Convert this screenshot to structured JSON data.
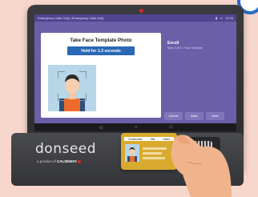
{
  "status_bar": {
    "left_text": "Emergency Calls Only  |  Emergency Calls Only",
    "time": "12:34"
  },
  "enroll_card": {
    "title": "Take Face Template Photo",
    "button_label": "Hold for 1-3 seconds"
  },
  "side_panel": {
    "title": "Enroll",
    "subtitle": "Step 3 of 5 : Face Template"
  },
  "actions": {
    "cancel": "Cancel",
    "back": "Back",
    "next": "Next"
  },
  "nav": {
    "back_glyph": "◁",
    "home_glyph": "○",
    "recent_glyph": "□"
  },
  "brand": {
    "logo": "donseed",
    "tagline_prefix": "a product of",
    "company": "CALSEWAY"
  },
  "id_card": {
    "fields": [
      "Construction",
      "Site",
      "Visitor"
    ]
  },
  "colors": {
    "screen": "#6b5fa8",
    "button_blue": "#2a67b5",
    "card_gold": "#d8ab2e",
    "background": "#f7d7cb"
  }
}
